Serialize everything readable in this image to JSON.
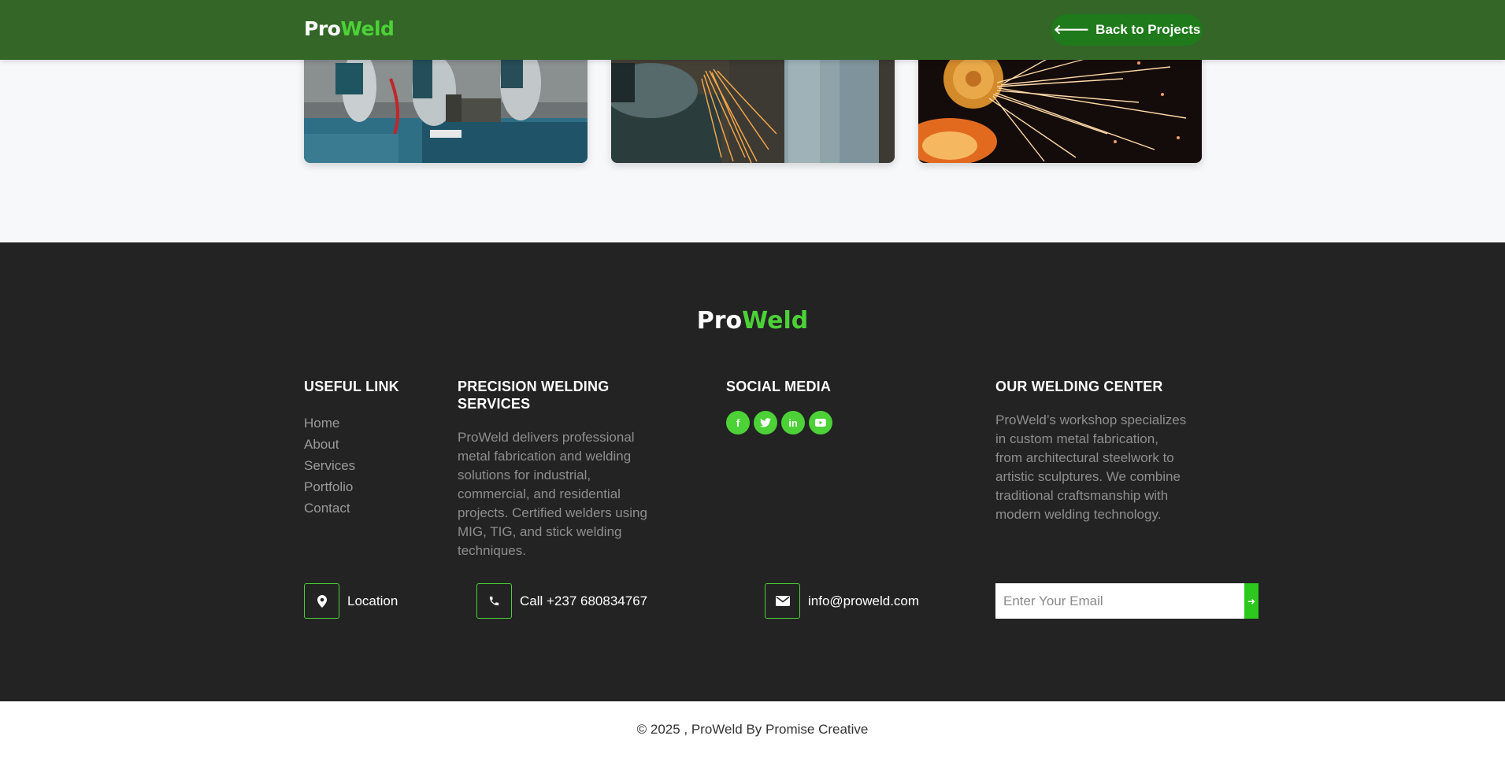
{
  "navbar": {
    "logo_pro": "Pro",
    "logo_weld": "Weld",
    "back_button": "Back to Projects"
  },
  "gallery": {
    "images": [
      {
        "alt": "welders-at-workbench"
      },
      {
        "alt": "grinding-sparks"
      },
      {
        "alt": "angle-grinder-sparks"
      }
    ]
  },
  "footer": {
    "logo_pro": "Pro",
    "logo_weld": "Weld",
    "useful_link": {
      "title": "USEFUL LINK",
      "items": [
        "Home",
        "About",
        "Services",
        "Portfolio",
        "Contact"
      ]
    },
    "services": {
      "title_line1": "PRECISION WELDING",
      "title_line2": "SERVICES",
      "lines": [
        "ProWeld delivers professional",
        "metal fabrication and welding",
        "solutions for industrial,",
        "commercial, and residential",
        "projects. Certified welders using",
        "MIG, TIG, and stick welding",
        "techniques."
      ]
    },
    "social": {
      "title": "SOCIAL MEDIA",
      "icons": [
        "facebook-icon",
        "twitter-icon",
        "linkedin-icon",
        "youtube-icon"
      ]
    },
    "center": {
      "title": "OUR WELDING CENTER",
      "lines": [
        "ProWeld’s workshop specializes",
        "in custom metal fabrication,",
        "from architectural steelwork to",
        "artistic sculptures. We combine",
        "traditional craftsmanship with",
        "modern welding technology."
      ]
    },
    "contact": {
      "location": "Location",
      "phone": "Call +237 680834767",
      "email": "info@proweld.com"
    },
    "newsletter": {
      "placeholder": "Enter Your Email"
    }
  },
  "copyright": "© 2025 , ProWeld By Promise Creative",
  "colors": {
    "nav_bg": "#336627",
    "accent": "#4cd137",
    "footer_bg": "#232323",
    "back_button_bg": "#1f7a1b"
  }
}
